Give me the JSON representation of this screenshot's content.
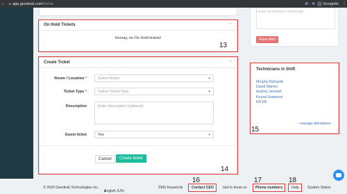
{
  "browser": {
    "url_host": "app.geedesk.com",
    "url_path": "/home",
    "profile_label": "Incognito"
  },
  "comment_area": {
    "placeholder": "Leave a comment (optional)",
    "raise_alert_label": "Raise Alert"
  },
  "on_hold": {
    "title": "On Hold Tickets",
    "message": "Hooray, no On Hold tickets!"
  },
  "create_ticket": {
    "title": "Create Ticket",
    "room_label": "Room / Location",
    "room_placeholder": "Select Room",
    "type_label": "Ticket Type",
    "type_placeholder": "Select Ticket Type",
    "description_label": "Description",
    "description_placeholder": "Enter description (optional)",
    "guest_label": "Guest ticket",
    "guest_value": "Yes",
    "cancel_label": "Cancel",
    "submit_label": "Create ticket",
    "required_mark": "*"
  },
  "technicians": {
    "title": "Technicians in Shift",
    "names": [
      "Morphy Richards",
      "David Warner",
      "Andrea Jermiah",
      "Krunal Sampson",
      "KB KB"
    ],
    "manage_label": "-- manage attendance"
  },
  "annotations": [
    "13",
    "14",
    "15",
    "16",
    "17",
    "18"
  ],
  "footer": {
    "copyright": "© 2020 Geedesk Technologies Inc.",
    "language": "English (US)",
    "sms": "SMS Keywords",
    "contact": "Contact CEO",
    "get_to_know": "Get to know us",
    "phone": "Phone numbers",
    "help": "Help",
    "status": "System Status"
  },
  "colors": {
    "annotation_red": "#e53935",
    "primary_green": "#1abc9c",
    "alert_red": "#e57373",
    "link_blue": "#3a73b8",
    "sidebar": "#1f3a44"
  }
}
